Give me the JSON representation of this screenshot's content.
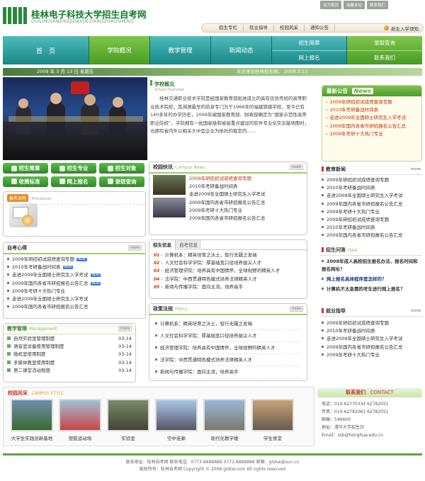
{
  "header": {
    "title": "桂林电子科技大学招生自考网",
    "subtitle": "GUILINDIANZIKEJIDAXUEZIKAOZHAOSHENG",
    "top_links": [
      "设为首页",
      "收藏本站",
      "联系我们"
    ],
    "subnav": [
      "招生专栏",
      "就业指导",
      "校园风采",
      "通知公告"
    ],
    "register": "新生入学须知"
  },
  "nav": {
    "home": "首　页",
    "about": "学院概况",
    "teaching": "教学管理",
    "news": "新闻动态",
    "guide": "招生简章",
    "apply": "网上报名",
    "query": "录取查询",
    "contact": "联系我们"
  },
  "datebar": {
    "date": "2009 年  3 月 13 日  星期五",
    "welcome": "欢迎来到桂林招生网，  2009.3.13"
  },
  "school": {
    "title": "学校概况",
    "en": "School Overview",
    "text": "　　桂林交通职业技术学院是经国家教育部批准成立的具有优良传统的高等职业技术院校，其溯源最早的前身专门为于1966年的福建铁路学校，至今已有140多年的办学历史，2006年被国家教育部、财政部确定为“国家示范性高等职业院校”，学院拥有一批国家级和省级重点建设的软件专业化实训基地图时，也拥有省内外以相关大中型企业为依托的稳定的……"
  },
  "announce": {
    "title": "最新公告",
    "en": "News",
    "items": [
      "2009年研招初试成绩查询专题",
      "2010年考研备战时间表",
      "走进2009年全国硕士研究生入学考试",
      "2009年国内各省市研招报名公告汇总",
      "2009年考研十大热门专业"
    ]
  },
  "quick_buttons": [
    "招生简章",
    "招生专业",
    "招生对象",
    "收费标准",
    "网上报名",
    "录取查询"
  ],
  "news_mini": {
    "title": "报名流程",
    "en": "Procedures"
  },
  "campus_news": {
    "title": "校园快讯",
    "en": "Campus News",
    "items": [
      "2009年研招初试成绩查询专题",
      "2010年考研备战时间表",
      "走进2009年全国硕士研究生入学考试",
      "2009年国内各省市研招报名公告汇总",
      "2009年考研十大热门专业",
      "2009年国内各省市研招报名公告汇总"
    ]
  },
  "edu_news": {
    "title": "教育新闻",
    "items": [
      "2009年研招初试成绩查询专题",
      "2010年考研备战时间表",
      "走进2009年全国硕士研究生入学考试",
      "2009年国内各省市研招报名公告汇总",
      "2009年考研十大热门专业",
      "2009年研招初试成绩查询专题",
      "2010年考研备战时间表",
      "2009年国内各省市研招报名公告汇总"
    ]
  },
  "self_study": {
    "title": "自考心得",
    "items": [
      "2009年研招初试成绩查询专题",
      "2010年考研备战时间表",
      "走进2009年全国硕士研究生入学考试",
      "2009年国内各省市研招报名公告汇总",
      "2009年考研十大热门专业",
      "走进2009年全国硕士研究生入学考试",
      "2009年国内各省市研招报名公告汇总"
    ]
  },
  "enroll_info": {
    "title": "招生信息",
    "tab": "自考信息",
    "items": [
      [
        "01",
        "计算机系：精英培育之沃土，智行无疆之发端"
      ],
      [
        "02",
        "人文社会科学学院：厚基础宽口径培养拔尖人才"
      ],
      [
        "03",
        "经济管理学院：培养具有中国情怀，全球视野的精英人才"
      ],
      [
        "04",
        "法学院：中西贯通特色模式培养法律精英人才"
      ],
      [
        "05",
        "新闻与传播学院：面向主流，培养高手"
      ]
    ]
  },
  "qa": {
    "title": "招生问答",
    "en": "Q&A",
    "items": [
      [
        "2008年成人高校招生报名办法、报名时间和报名网址？",
        true
      ],
      [
        "网上报名具体程序是怎样的？",
        false
      ],
      [
        "计算机不太急需的考生进行网上报名？",
        true
      ]
    ]
  },
  "teach": {
    "title": "教学管理",
    "en": "Management",
    "items": [
      [
        "自然实验室管理制度",
        "03-14"
      ],
      [
        "语音室设备使用管理制度",
        "03-14"
      ],
      [
        "微机室使用制度",
        "03-14"
      ],
      [
        "多媒体教室使用制度",
        "03-14"
      ],
      [
        "第二课堂活动制度",
        "03-14"
      ]
    ]
  },
  "policy": {
    "title": "政策法规",
    "en": "Policy",
    "items": [
      "计算机系：精英培育之沃土，智行无疆之发端",
      "人文社会科学学院：厚基础宽口径培养拔尖人才",
      "经济管理学院：培养具有中国情怀，全球视野的精英人才",
      "法学院：中西贯通特色模式培养法律精英人才",
      "新闻与传播学院：面向主流，培养高手"
    ]
  },
  "career": {
    "title": "就业指导",
    "items": [
      "2009年研招初试成绩查询专题",
      "2010年考研备战时间表",
      "走进2009年全国硕士研究生入学考试",
      "2009年国内各省市研招报名公告汇总",
      "2009年考研十大热门专业"
    ]
  },
  "campus_style": {
    "title": "校园风采",
    "en": "CAMPUS STYLE",
    "captions": [
      "大学生实践创新基地",
      "塑胶运动场",
      "实验室",
      "空中走廊",
      "现代化教学楼",
      "学生食堂"
    ]
  },
  "contact": {
    "title": "联系我们",
    "en": "CONTACT",
    "lines": [
      "电话：010-62770334 62782051",
      "传真：010-62782061 62782051",
      "邮编：546600",
      "地址：清华大学招生办",
      "Email：zsb@tsinghua.edu.cn"
    ]
  },
  "footer": {
    "line1": "联系地址：桂林自考网  联系电话：0773-8888888 0773-8888888  邮箱：glzkw@sun.cn",
    "line2": "版权所有：桂林自考网  Copyright © 2008 glzkw.com All rights reserved"
  }
}
